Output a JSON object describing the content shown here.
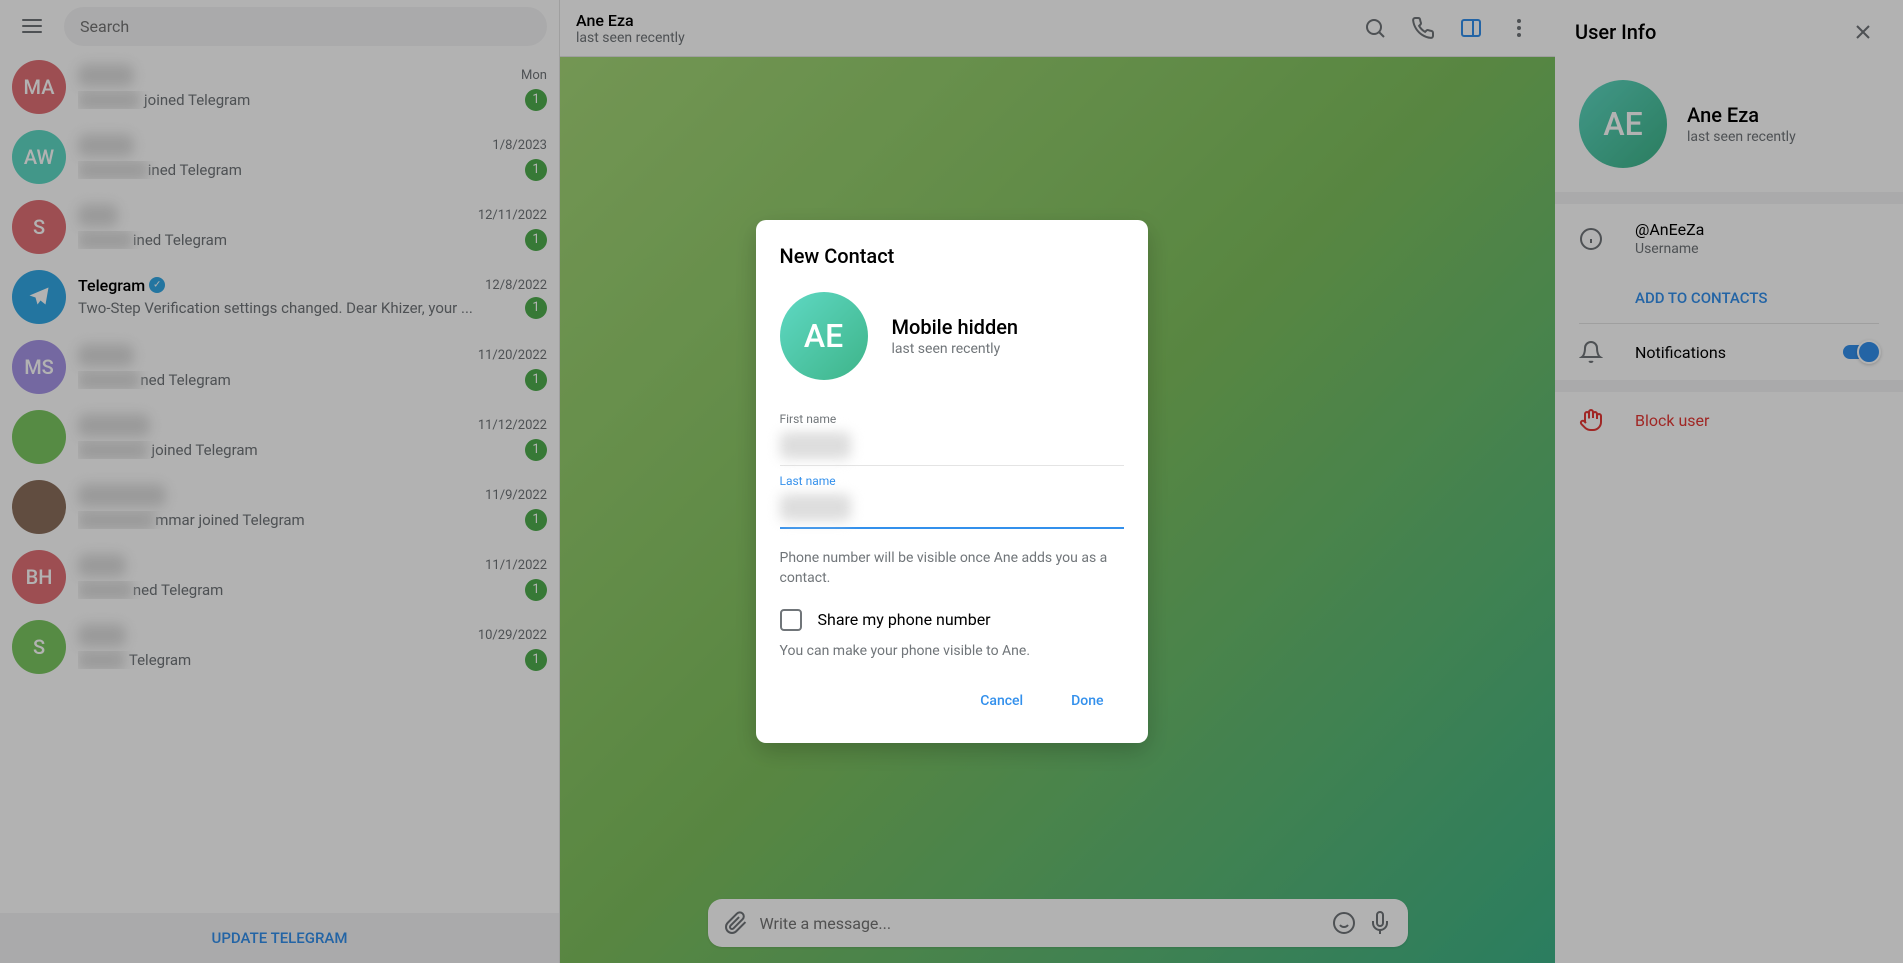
{
  "sidebar": {
    "search_placeholder": "Search",
    "chats": [
      {
        "avatar_text": "MA",
        "avatar_bg": "#e17076",
        "name_blur": "xxxxx",
        "date": "Mon",
        "preview_prefix_blur": "xxx",
        "preview_suffix": " joined Telegram",
        "badge": "1"
      },
      {
        "avatar_text": "AW",
        "avatar_bg": "#5fd9c4",
        "name_blur": "xxxxx",
        "date": "1/8/2023",
        "preview_prefix_blur": "xxxx",
        "preview_suffix": "ined Telegram",
        "badge": "1"
      },
      {
        "avatar_text": "S",
        "avatar_bg": "#e17076",
        "name_blur": "xxx",
        "date": "12/11/2022",
        "preview_prefix_blur": "xx",
        "preview_suffix": "ined Telegram",
        "badge": "1"
      },
      {
        "avatar_text": "",
        "avatar_bg": "#33a8e5",
        "is_telegram": true,
        "name": "Telegram",
        "verified": true,
        "date": "12/8/2022",
        "preview": "Two-Step Verification settings changed. Dear Khizer, your ...",
        "badge": "1"
      },
      {
        "avatar_text": "MS",
        "avatar_bg": "#a695e7",
        "name_blur": "xxxxx",
        "date": "11/20/2022",
        "preview_prefix_blur": "xxx",
        "preview_suffix": "ned Telegram",
        "badge": "1"
      },
      {
        "avatar_text": "",
        "avatar_bg": "#7bc862",
        "avatar_img": true,
        "name_blur": "xxxxxxx",
        "date": "11/12/2022",
        "preview_prefix_blur": "xxxx",
        "preview_suffix": " joined Telegram",
        "badge": "1"
      },
      {
        "avatar_text": "",
        "avatar_bg": "#8b6f5c",
        "avatar_img": true,
        "name_blur": "xxxxxxxxx",
        "date": "11/9/2022",
        "preview_prefix_blur": "xxxxx",
        "preview_suffix": "mmar joined Telegram",
        "badge": "1"
      },
      {
        "avatar_text": "BH",
        "avatar_bg": "#e17076",
        "name_blur": "xxxx",
        "date": "11/1/2022",
        "preview_prefix_blur": "xx",
        "preview_suffix": "ned Telegram",
        "badge": "1"
      },
      {
        "avatar_text": "S",
        "avatar_bg": "#7bc862",
        "name_blur": "xxxx",
        "date": "10/29/2022",
        "preview_prefix_blur": "x",
        "preview_suffix": " Telegram",
        "badge": "1"
      }
    ],
    "update_label": "UPDATE TELEGRAM"
  },
  "header": {
    "name": "Ane Eza",
    "status": "last seen recently"
  },
  "composer": {
    "placeholder": "Write a message..."
  },
  "userinfo": {
    "title": "User Info",
    "avatar_text": "AE",
    "name": "Ane Eza",
    "status": "last seen recently",
    "username": "@AnEeZa",
    "username_label": "Username",
    "add_contacts": "ADD TO CONTACTS",
    "notifications_label": "Notifications",
    "block_label": "Block user"
  },
  "modal": {
    "title": "New Contact",
    "avatar_text": "AE",
    "mobile_label": "Mobile hidden",
    "status": "last seen recently",
    "first_name_label": "First name",
    "first_name_value_blur": "xxx",
    "last_name_label": "Last name",
    "last_name_value_blur": "xxx",
    "note1": "Phone number will be visible once Ane adds you as a contact.",
    "checkbox_label": "Share my phone number",
    "note2": "You can make your phone visible to Ane.",
    "cancel": "Cancel",
    "done": "Done"
  }
}
